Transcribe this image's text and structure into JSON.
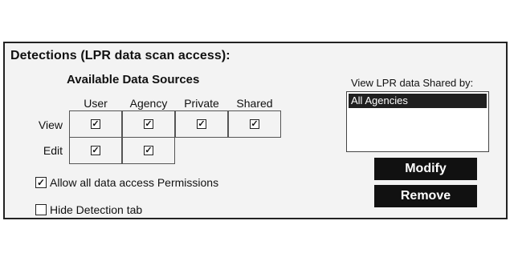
{
  "panel": {
    "title": "Detections (LPR data scan access):",
    "sources_title": "Available Data Sources"
  },
  "grid": {
    "columns": [
      "User",
      "Agency",
      "Private",
      "Shared"
    ],
    "rows": [
      {
        "label": "View",
        "checked": [
          true,
          true,
          true,
          true
        ]
      },
      {
        "label": "Edit",
        "checked": [
          true,
          true,
          null,
          null
        ]
      }
    ]
  },
  "options": {
    "allow_all_label": "Allow all data access Permissions",
    "allow_all_checked": true,
    "hide_tab_label": "Hide Detection tab",
    "hide_tab_checked": false
  },
  "shared": {
    "label": "View LPR data Shared by:",
    "items": [
      "All Agencies"
    ]
  },
  "buttons": {
    "modify": "Modify",
    "remove": "Remove"
  }
}
